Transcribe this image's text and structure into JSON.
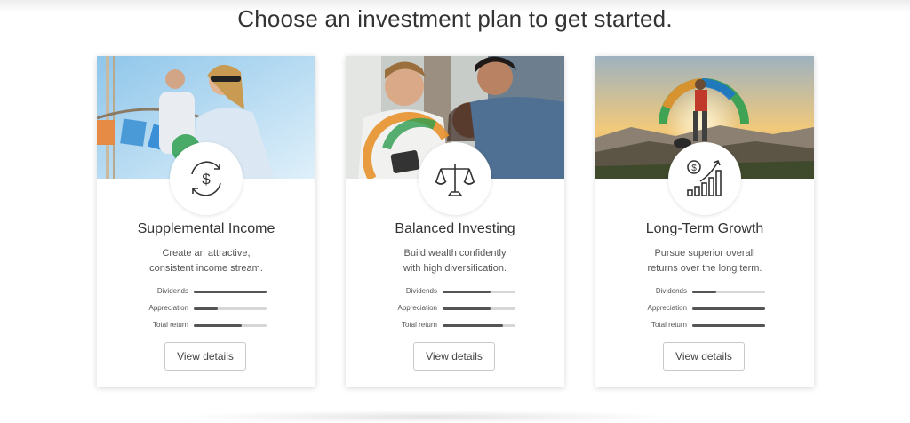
{
  "page": {
    "title": "Choose an investment plan to get started."
  },
  "plans": [
    {
      "title": "Supplemental Income",
      "desc_line1": "Create an attractive,",
      "desc_line2": "consistent income stream.",
      "icon": "dollar-cycle-icon",
      "metrics": [
        {
          "label": "Dividends",
          "level": 1.0
        },
        {
          "label": "Appreciation",
          "level": 0.33
        },
        {
          "label": "Total return",
          "level": 0.66
        }
      ],
      "button": "View details"
    },
    {
      "title": "Balanced Investing",
      "desc_line1": "Build wealth confidently",
      "desc_line2": "with high diversification.",
      "icon": "balance-scale-icon",
      "metrics": [
        {
          "label": "Dividends",
          "level": 0.66
        },
        {
          "label": "Appreciation",
          "level": 0.66
        },
        {
          "label": "Total return",
          "level": 0.83
        }
      ],
      "button": "View details"
    },
    {
      "title": "Long-Term Growth",
      "desc_line1": "Pursue superior overall",
      "desc_line2": "returns over the long term.",
      "icon": "growth-chart-icon",
      "metrics": [
        {
          "label": "Dividends",
          "level": 0.33
        },
        {
          "label": "Appreciation",
          "level": 1.0
        },
        {
          "label": "Total return",
          "level": 1.0
        }
      ],
      "button": "View details"
    }
  ],
  "colors": {
    "metric_fill": "#555555",
    "metric_track": "#d6d6d6",
    "brand_arc": [
      "#e8912b",
      "#1e74c6",
      "#3fa0e0",
      "#2e9e4f",
      "#8cc63f",
      "#f2c230"
    ]
  }
}
